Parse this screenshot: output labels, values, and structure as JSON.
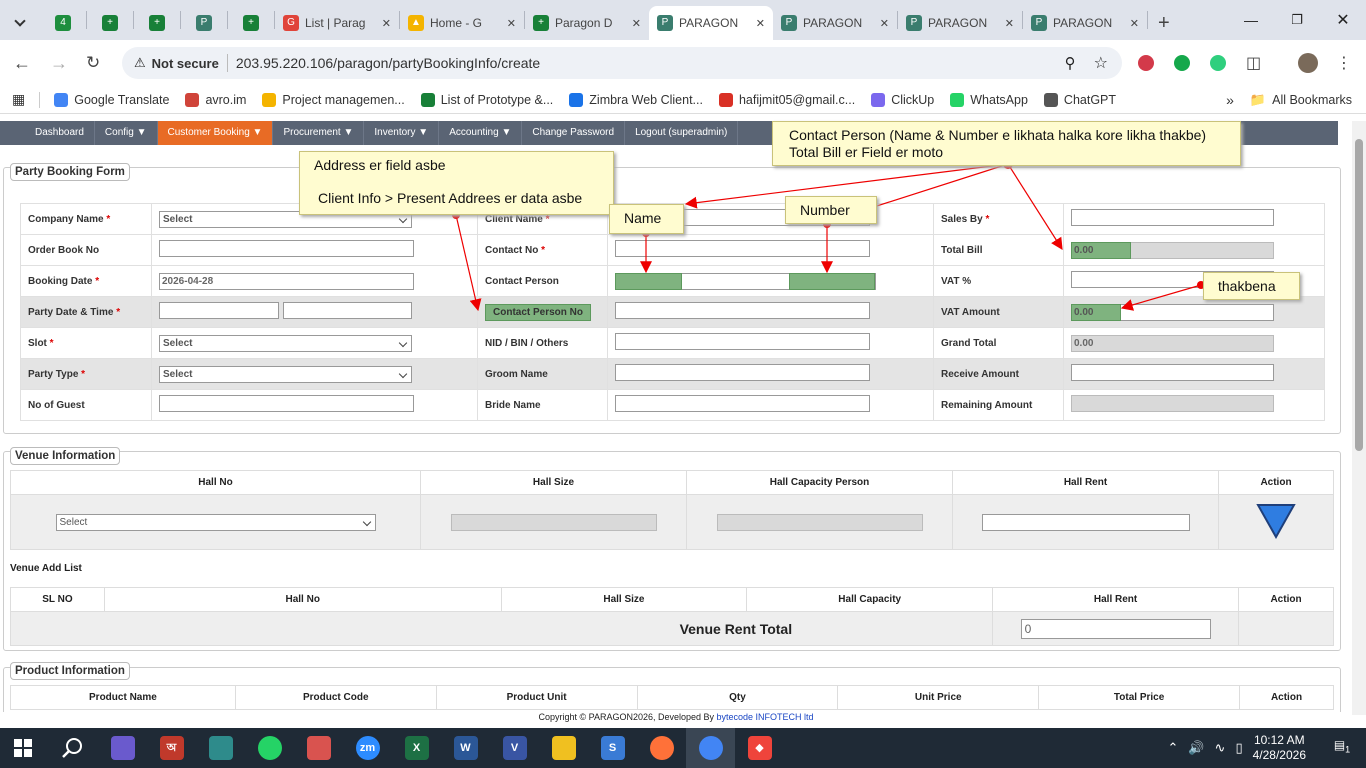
{
  "browser": {
    "tabs": [
      {
        "label": "",
        "color": "#1e8e3e",
        "glyph": "4"
      },
      {
        "label": "",
        "color": "#188038",
        "glyph": "+"
      },
      {
        "label": "",
        "color": "#188038",
        "glyph": "+"
      },
      {
        "label": "",
        "color": "#3a7d6e",
        "glyph": "P"
      },
      {
        "label": "",
        "color": "#188038",
        "glyph": "+"
      },
      {
        "label": "List | Parag",
        "color": "#e0443a",
        "glyph": "G"
      },
      {
        "label": "Home - G",
        "color": "#f4b400",
        "glyph": "▲"
      },
      {
        "label": "Paragon D",
        "color": "#188038",
        "glyph": "+"
      },
      {
        "label": "PARAGON",
        "color": "#3a7d6e",
        "glyph": "P"
      },
      {
        "label": "PARAGON",
        "color": "#3a7d6e",
        "glyph": "P"
      },
      {
        "label": "PARAGON",
        "color": "#3a7d6e",
        "glyph": "P"
      },
      {
        "label": "PARAGON",
        "color": "#3a7d6e",
        "glyph": "P"
      }
    ],
    "new_tab": "+",
    "security": "Not secure",
    "url": "203.95.220.106/paragon/partyBookingInfo/create",
    "bookmarks": [
      {
        "label": "Google Translate",
        "color": "#4285f4"
      },
      {
        "label": "avro.im",
        "color": "#d0443a"
      },
      {
        "label": "Project managemen...",
        "color": "#f4b400"
      },
      {
        "label": "List of Prototype &...",
        "color": "#188038"
      },
      {
        "label": "Zimbra Web Client...",
        "color": "#1a73e8"
      },
      {
        "label": "hafijmit05@gmail.c...",
        "color": "#d93025"
      },
      {
        "label": "ClickUp",
        "color": "#7b68ee"
      },
      {
        "label": "WhatsApp",
        "color": "#25d366"
      },
      {
        "label": "ChatGPT",
        "color": "#555555"
      }
    ],
    "all_bookmarks": "All Bookmarks"
  },
  "nav": [
    "Dashboard",
    "Config ▼",
    "Customer Booking ▼",
    "Procurement ▼",
    "Inventory ▼",
    "Accounting ▼",
    "Change Password",
    "Logout (superadmin)"
  ],
  "form": {
    "legend": "Party Booking Form",
    "col1": [
      {
        "label": "Company Name",
        "req": "*",
        "value": "Select"
      },
      {
        "label": "Order Book No",
        "req": "",
        "value": ""
      },
      {
        "label": "Booking Date",
        "req": "*",
        "value": "2026-04-28"
      },
      {
        "label": "Party Date & Time",
        "req": "*",
        "value": ""
      },
      {
        "label": "Slot",
        "req": "*",
        "value": "Select"
      },
      {
        "label": "Party Type",
        "req": "*",
        "value": "Select"
      },
      {
        "label": "No of Guest",
        "req": "",
        "value": ""
      }
    ],
    "col2": [
      {
        "label": "Client Name",
        "req": "*"
      },
      {
        "label": "Contact No",
        "req": "*"
      },
      {
        "label": "Contact Person",
        "req": ""
      },
      {
        "label": "Contact Person No",
        "req": ""
      },
      {
        "label": "NID / BIN / Others",
        "req": ""
      },
      {
        "label": "Groom Name",
        "req": ""
      },
      {
        "label": "Bride Name",
        "req": ""
      }
    ],
    "col3": [
      {
        "label": "Sales By",
        "req": "*",
        "value": ""
      },
      {
        "label": "Total Bill",
        "req": "",
        "value": "0.00"
      },
      {
        "label": "VAT %",
        "req": "",
        "value": ""
      },
      {
        "label": "VAT Amount",
        "req": "",
        "value": "0.00"
      },
      {
        "label": "Grand Total",
        "req": "",
        "value": "0.00"
      },
      {
        "label": "Receive Amount",
        "req": "",
        "value": ""
      },
      {
        "label": "Remaining Amount",
        "req": "",
        "value": ""
      }
    ]
  },
  "venue": {
    "legend": "Venue Information",
    "headers": [
      "Hall No",
      "Hall Size",
      "Hall Capacity Person",
      "Hall Rent",
      "Action"
    ],
    "hall_select": "Select",
    "add_list_title": "Venue Add List",
    "list_headers": [
      "SL NO",
      "Hall No",
      "Hall Size",
      "Hall Capacity",
      "Hall Rent",
      "Action"
    ],
    "total_label": "Venue Rent Total",
    "total_value": "0"
  },
  "product": {
    "legend": "Product Information",
    "headers": [
      "Product Name",
      "Product Code",
      "Product Unit",
      "Qty",
      "Unit Price",
      "Total Price",
      "Action"
    ]
  },
  "notes": {
    "address": [
      "Address er field asbe",
      "Client Info > Present Addrees er data asbe"
    ],
    "contact": [
      "Contact Person (Name & Number e likhata halka kore likha thakbe)",
      "Total Bill er Field er moto"
    ],
    "name": "Name",
    "number": "Number",
    "thakbena": "thakbena"
  },
  "footer": {
    "prefix": "Copyright © PARAGON2026, Developed By ",
    "link": "bytecode INFOTECH ltd"
  },
  "taskbar": {
    "time": "10:12 AM",
    "date": "4/28/2026",
    "apps": [
      {
        "name": "copilot",
        "color": "#6a5acd",
        "glyph": ""
      },
      {
        "name": "app-red",
        "color": "#c0392b",
        "glyph": "অ"
      },
      {
        "name": "app-teal",
        "color": "#2e8b8b",
        "glyph": ""
      },
      {
        "name": "whatsapp",
        "color": "#25d366",
        "glyph": ""
      },
      {
        "name": "app-multi",
        "color": "#d9534f",
        "glyph": ""
      },
      {
        "name": "zoom",
        "color": "#2d8cff",
        "glyph": "zm"
      },
      {
        "name": "excel",
        "color": "#1d7044",
        "glyph": "X"
      },
      {
        "name": "word",
        "color": "#2b5797",
        "glyph": "W"
      },
      {
        "name": "visio",
        "color": "#3955a3",
        "glyph": "V"
      },
      {
        "name": "sticky",
        "color": "#f0c020",
        "glyph": ""
      },
      {
        "name": "app-s",
        "color": "#3a7bd5",
        "glyph": "S"
      },
      {
        "name": "firefox",
        "color": "#ff7139",
        "glyph": ""
      },
      {
        "name": "chrome",
        "color": "#4285f4",
        "glyph": ""
      },
      {
        "name": "anydesk",
        "color": "#ef443b",
        "glyph": "◆"
      }
    ],
    "notif": "1"
  }
}
